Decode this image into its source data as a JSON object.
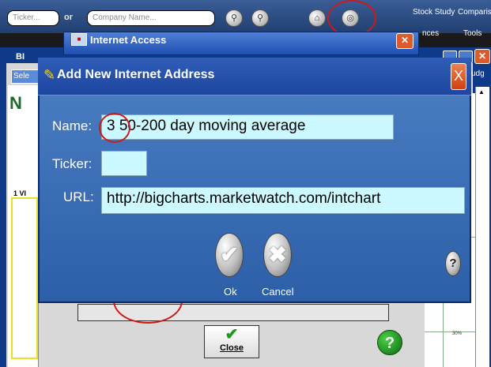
{
  "toolbar": {
    "ticker_placeholder": "Ticker...",
    "or_label": "or",
    "company_placeholder": "Company Name...",
    "stock_study": "Stock Study",
    "comparison": "Compariso"
  },
  "internet_access_window": {
    "title": "Internet Access",
    "menu_partial": "nces",
    "tools": "Tools"
  },
  "background_window": {
    "title_partial": "BI",
    "tab_partial": "Sele",
    "right_partial": "udg",
    "section_number": "1",
    "section_label": "VI",
    "logo_text": "N",
    "percent_label": "30%",
    "close_label": "Close",
    "help_glyph": "?"
  },
  "dialog": {
    "title": "Add New Internet Address",
    "close_glyph": "X",
    "name_label": "Name:",
    "name_value": "3 50-200 day moving average",
    "ticker_label": "Ticker:",
    "ticker_value": "",
    "url_label": "URL:",
    "url_value": "http://bigcharts.marketwatch.com/intchart",
    "ok_label": "Ok",
    "cancel_label": "Cancel",
    "help_glyph": "?"
  }
}
